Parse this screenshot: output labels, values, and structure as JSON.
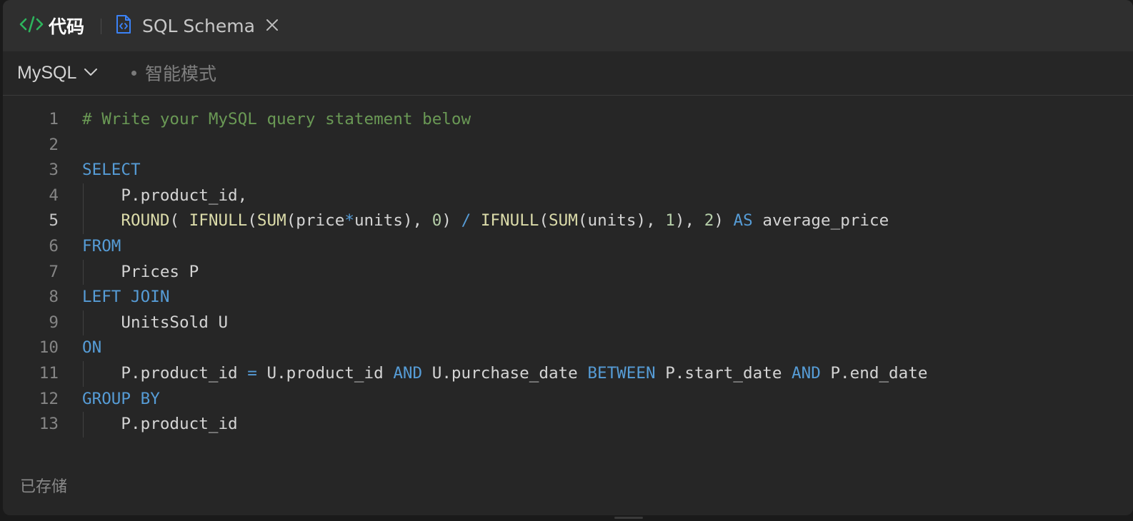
{
  "tabs": {
    "code_label": "代码",
    "schema_label": "SQL Schema"
  },
  "toolbar": {
    "language": "MySQL",
    "smart_mode": "智能模式"
  },
  "editor": {
    "lines": [
      {
        "n": "1",
        "tokens": [
          {
            "t": "# Write your MySQL query statement below",
            "c": "comment"
          }
        ]
      },
      {
        "n": "2",
        "tokens": []
      },
      {
        "n": "3",
        "tokens": [
          {
            "t": "SELECT",
            "c": "kw"
          }
        ]
      },
      {
        "n": "4",
        "indent": true,
        "tokens": [
          {
            "t": "P.product_id,",
            "c": "plain"
          }
        ]
      },
      {
        "n": "5",
        "indent": true,
        "active": true,
        "tokens": [
          {
            "t": "ROUND",
            "c": "fn"
          },
          {
            "t": "( ",
            "c": "plain"
          },
          {
            "t": "IFNULL",
            "c": "fn"
          },
          {
            "t": "(",
            "c": "plain"
          },
          {
            "t": "SUM",
            "c": "fn"
          },
          {
            "t": "(price",
            "c": "plain"
          },
          {
            "t": "*",
            "c": "kw"
          },
          {
            "t": "units), ",
            "c": "plain"
          },
          {
            "t": "0",
            "c": "num"
          },
          {
            "t": ") ",
            "c": "plain"
          },
          {
            "t": "/",
            "c": "kw"
          },
          {
            "t": " ",
            "c": "plain"
          },
          {
            "t": "IFNULL",
            "c": "fn"
          },
          {
            "t": "(",
            "c": "plain"
          },
          {
            "t": "SUM",
            "c": "fn"
          },
          {
            "t": "(units), ",
            "c": "plain"
          },
          {
            "t": "1",
            "c": "num"
          },
          {
            "t": "), ",
            "c": "plain"
          },
          {
            "t": "2",
            "c": "num"
          },
          {
            "t": ") ",
            "c": "plain"
          },
          {
            "t": "AS",
            "c": "kw"
          },
          {
            "t": " average_price",
            "c": "plain"
          }
        ]
      },
      {
        "n": "6",
        "tokens": [
          {
            "t": "FROM",
            "c": "kw"
          }
        ]
      },
      {
        "n": "7",
        "indent": true,
        "tokens": [
          {
            "t": "Prices P",
            "c": "plain"
          }
        ]
      },
      {
        "n": "8",
        "tokens": [
          {
            "t": "LEFT JOIN",
            "c": "kw"
          }
        ]
      },
      {
        "n": "9",
        "indent": true,
        "tokens": [
          {
            "t": "UnitsSold U",
            "c": "plain"
          }
        ]
      },
      {
        "n": "10",
        "tokens": [
          {
            "t": "ON",
            "c": "kw"
          }
        ]
      },
      {
        "n": "11",
        "indent": true,
        "tokens": [
          {
            "t": "P.product_id ",
            "c": "plain"
          },
          {
            "t": "=",
            "c": "kw"
          },
          {
            "t": " U.product_id ",
            "c": "plain"
          },
          {
            "t": "AND",
            "c": "kw"
          },
          {
            "t": " U.purchase_date ",
            "c": "plain"
          },
          {
            "t": "BETWEEN",
            "c": "kw"
          },
          {
            "t": " P.start_date ",
            "c": "plain"
          },
          {
            "t": "AND",
            "c": "kw"
          },
          {
            "t": " P.end_date",
            "c": "plain"
          }
        ]
      },
      {
        "n": "12",
        "tokens": [
          {
            "t": "GROUP BY",
            "c": "kw"
          }
        ]
      },
      {
        "n": "13",
        "indent": true,
        "tokens": [
          {
            "t": "P.product_id",
            "c": "plain"
          }
        ]
      }
    ]
  },
  "status": {
    "saved": "已存储"
  },
  "colors": {
    "accent_code_icon": "#2db55d",
    "schema_icon": "#3b82f6",
    "keyword": "#569cd6",
    "function": "#dcdcaa",
    "number": "#b5cea8",
    "comment": "#6a9955"
  },
  "icons": {
    "code": "code-brackets-icon",
    "schema": "file-code-icon",
    "close": "close-icon",
    "dropdown": "chevron-down-icon"
  }
}
